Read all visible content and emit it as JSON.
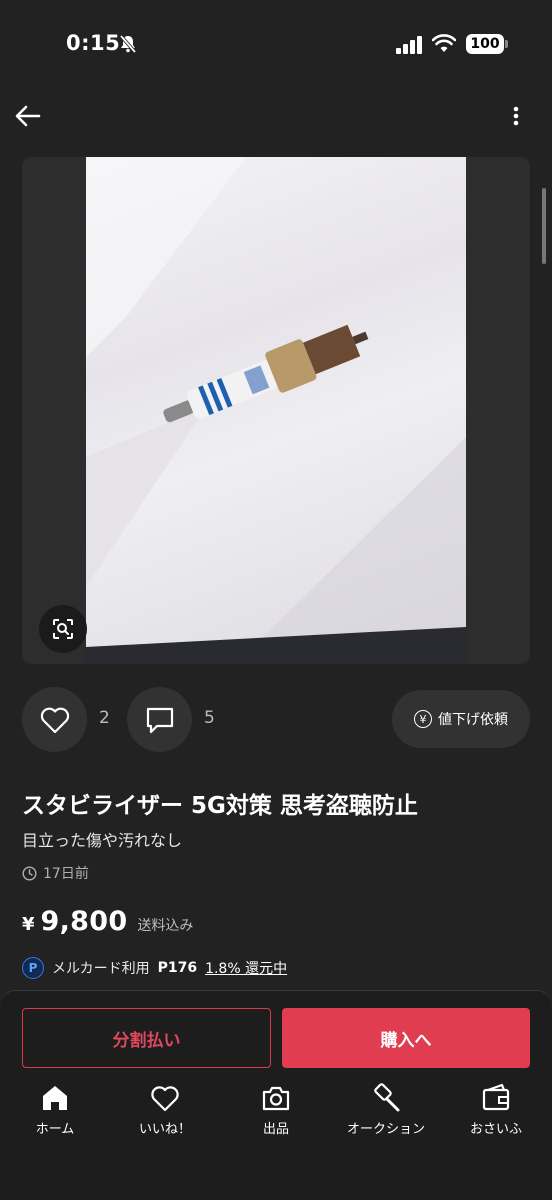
{
  "status_bar": {
    "time": "0:15",
    "battery": "100"
  },
  "actions": {
    "like_count": "2",
    "comment_count": "5",
    "price_down_label": "値下げ依頼"
  },
  "product": {
    "title": "スタビライザー 5G対策 思考盗聴防止",
    "condition": "目立った傷や汚れなし",
    "posted": "17日前",
    "price_symbol": "¥",
    "price": "9,800",
    "shipping": "送料込み",
    "points_label": "メルカード利用",
    "points_value": "P176",
    "cashback": "1.8% 還元中"
  },
  "buttons": {
    "installment": "分割払い",
    "buy": "購入へ"
  },
  "tabs": [
    {
      "label": "ホーム",
      "icon": "home-icon"
    },
    {
      "label": "いいね！",
      "icon": "heart-icon"
    },
    {
      "label": "出品",
      "icon": "camera-icon"
    },
    {
      "label": "オークション",
      "icon": "gavel-icon"
    },
    {
      "label": "おさいふ",
      "icon": "wallet-icon"
    }
  ],
  "colors": {
    "background": "#222222",
    "accent": "#e03d51",
    "point_blue": "#3a78d6"
  }
}
